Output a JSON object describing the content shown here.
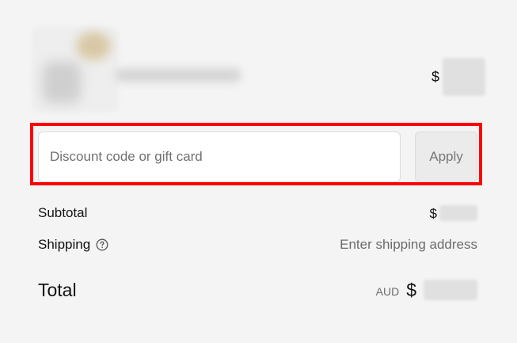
{
  "product": {
    "image_icon": "product-thumbnail",
    "currency_symbol": "$"
  },
  "discount": {
    "placeholder": "Discount code or gift card",
    "value": "",
    "apply_label": "Apply"
  },
  "summary": {
    "subtotal_label": "Subtotal",
    "subtotal_currency_symbol": "$",
    "shipping_label": "Shipping",
    "shipping_help_icon": "question-circle-icon",
    "shipping_value": "Enter shipping address",
    "total_label": "Total",
    "total_currency_code": "AUD",
    "total_currency_symbol": "$"
  },
  "colors": {
    "background": "#f4f4f4",
    "highlight": "#ff0000",
    "button_background": "#ebebeb",
    "muted_text": "#6b6b6b"
  }
}
